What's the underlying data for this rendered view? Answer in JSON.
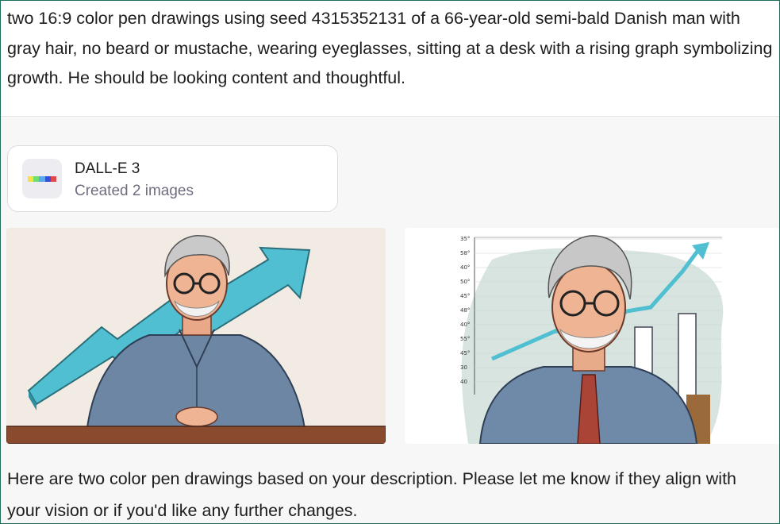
{
  "user_message": {
    "text": "two 16:9 color pen drawings using seed 4315352131 of a 66-year-old semi-bald Danish man with gray hair, no beard or mustache, wearing eyeglasses, sitting at a desk with a rising graph symbolizing growth. He should be looking content and thoughtful."
  },
  "tool_card": {
    "title": "DALL-E 3",
    "subtitle": "Created 2 images",
    "icon": "dalle-color-stripe-icon",
    "stripe_colors": [
      "#f5e04a",
      "#6ee06e",
      "#5aa9f0",
      "#3a4fd8",
      "#e04a4a"
    ]
  },
  "images": [
    {
      "name": "generated-image-1",
      "icon": "man-at-desk-with-arrow-illustration"
    },
    {
      "name": "generated-image-2",
      "icon": "man-with-bar-chart-illustration",
      "axis_labels": [
        "35°",
        "58°",
        "40°",
        "50°",
        "45°",
        "48°",
        "40°",
        "55°",
        "45°",
        "30",
        "40"
      ]
    }
  ],
  "assistant_reply": {
    "text": "Here are two color pen drawings based on your description. Please let me know if they align with your vision or if you'd like any further changes."
  },
  "colors": {
    "frame_border": "#1e6b5a",
    "assistant_bg": "#f7f7f8",
    "arrow_teal": "#4fbfd1",
    "shirt_blue": "#6c86a3"
  }
}
